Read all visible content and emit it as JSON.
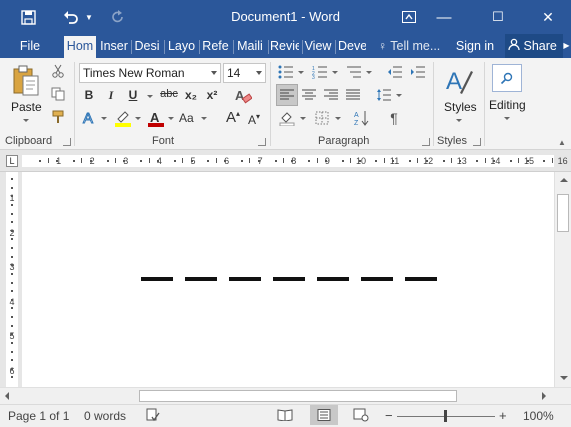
{
  "window": {
    "title": "Document1 - Word",
    "save_icon": "save-icon",
    "undo_icon": "undo-icon",
    "redo_icon": "redo-icon",
    "ribbon_display_icon": "ribbon-display-options-icon",
    "minimize_label": "—",
    "maximize_label": "☐",
    "close_label": "✕"
  },
  "tabs": [
    {
      "label": "File",
      "active": false
    },
    {
      "label": "Hom",
      "active": true
    },
    {
      "label": "Inser",
      "active": false
    },
    {
      "label": "Desi",
      "active": false
    },
    {
      "label": "Layo",
      "active": false
    },
    {
      "label": "Refe",
      "active": false
    },
    {
      "label": "Maili",
      "active": false
    },
    {
      "label": "Revie",
      "active": false
    },
    {
      "label": "View",
      "active": false
    },
    {
      "label": "Deve",
      "active": false
    }
  ],
  "tell_me": "Tell me...",
  "sign_in": "Sign in",
  "share": "Share",
  "ribbon": {
    "clipboard": {
      "label": "Clipboard",
      "paste": "Paste"
    },
    "font": {
      "label": "Font",
      "font_name": "Times New Roman",
      "font_size": "14",
      "bold": "B",
      "italic": "I",
      "underline": "U",
      "strikethrough": "abc",
      "subscript": "x₂",
      "superscript": "x²",
      "grow_font": "A",
      "shrink_font": "A",
      "change_case": "Aa",
      "font_color": "#c00000",
      "highlight_color": "#ffff00"
    },
    "paragraph": {
      "label": "Paragraph"
    },
    "styles": {
      "label": "Styles",
      "button": "Styles"
    },
    "editing": {
      "button": "Editing"
    }
  },
  "ruler": {
    "tab_selector": "L",
    "numbers": [
      "1",
      "2",
      "3",
      "4",
      "5",
      "6",
      "7",
      "8",
      "9",
      "10",
      "11",
      "12",
      "13",
      "14",
      "15",
      "16"
    ],
    "vertical_numbers": [
      "1",
      "2",
      "3",
      "4",
      "5",
      "6"
    ]
  },
  "document": {
    "dash_count": 7,
    "content_description_free": true
  },
  "status": {
    "page": "Page 1 of 1",
    "words": "0 words",
    "zoom": "100%",
    "zoom_minus": "−",
    "zoom_plus": "+"
  }
}
